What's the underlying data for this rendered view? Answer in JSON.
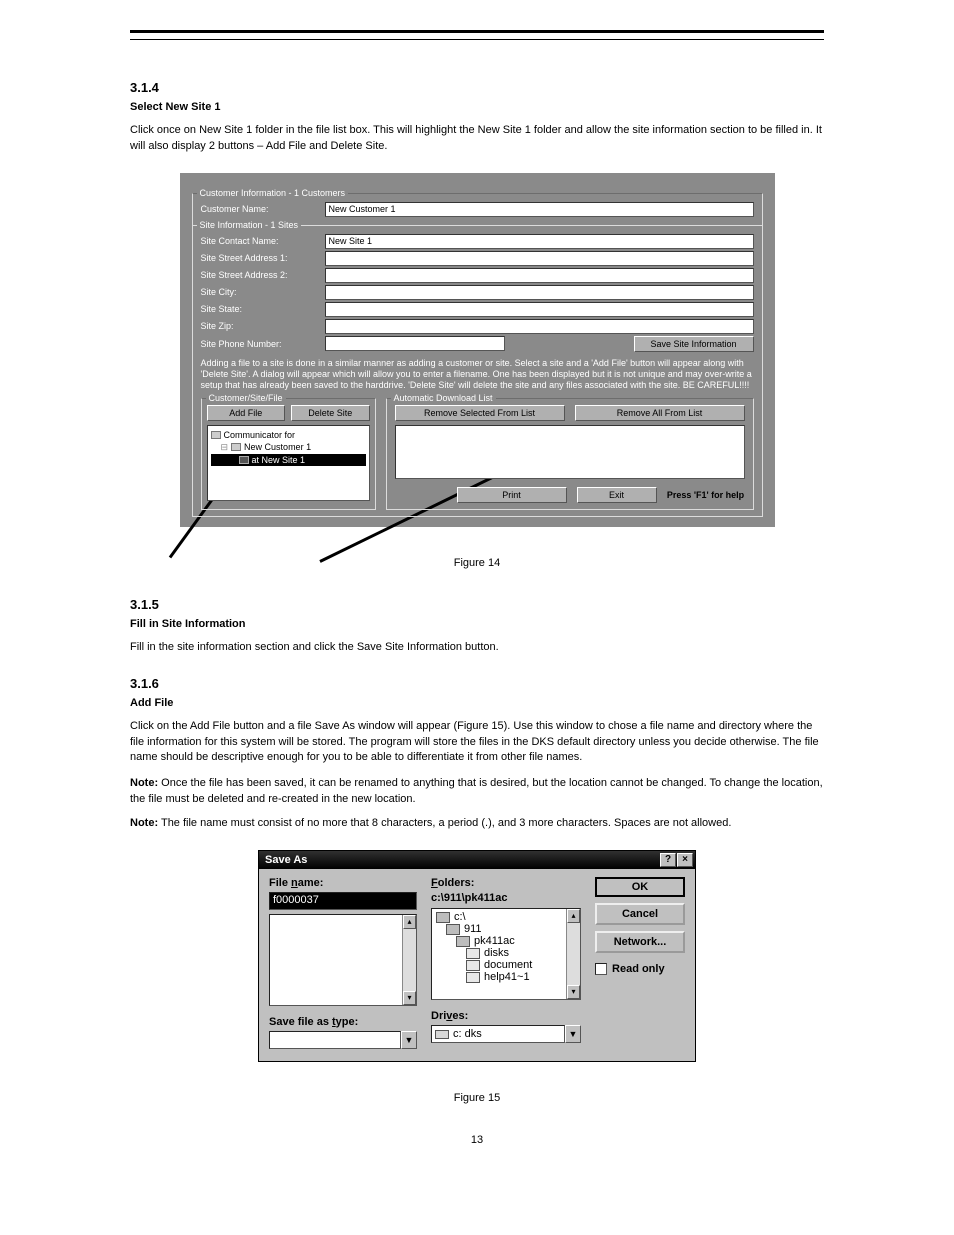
{
  "section1": {
    "num": "3.1.4",
    "title": "Select New Site 1"
  },
  "para1": "Click once on New Site 1 folder in the file list box. This will highlight the New Site 1 folder and allow the site information section to be filled in. It will also display 2 buttons – Add File and Delete Site.",
  "fig1": {
    "group_customer": "Customer Information - 1 Customers",
    "customer_name_label": "Customer Name:",
    "customer_name_value": "New Customer 1",
    "group_site": "Site Information - 1 Sites",
    "labels": {
      "contact": "Site Contact Name:",
      "addr1": "Site Street Address 1:",
      "addr2": "Site Street Address 2:",
      "city": "Site City:",
      "state": "Site State:",
      "zip": "Site Zip:",
      "phone": "Site Phone Number:"
    },
    "site_contact_value": "New Site 1",
    "save_btn": "Save Site Information",
    "help": "Adding a file to a site is done in a similar manner as adding a customer or site. Select a site and a 'Add File' button will appear along with 'Delete Site'. A dialog will appear which will allow you to enter a filename. One has been displayed but it is not unique and may over-write a setup that has already been saved to the harddrive. 'Delete Site' will delete the site and any files associated with the site. BE CAREFUL!!!!",
    "group_csf": "Customer/Site/File",
    "add_file_btn": "Add File",
    "delete_site_btn": "Delete Site",
    "tree": {
      "root": "Communicator for",
      "cust": "New Customer 1",
      "site": "at New Site 1"
    },
    "group_dl": "Automatic Download List",
    "remove_sel_btn": "Remove Selected From List",
    "remove_all_btn": "Remove All From List",
    "print_btn": "Print",
    "exit_btn": "Exit",
    "f1": "Press 'F1' for help"
  },
  "caption1": "Figure 14",
  "section2": {
    "num": "3.1.5",
    "title": "Fill in Site Information"
  },
  "para2": "Fill in the site information section and click the Save Site Information button.",
  "section3": {
    "num": "3.1.6",
    "title": "Add File"
  },
  "para3": "Click on the Add File button and a file Save As window will appear (Figure 15). Use this window to chose a file name and directory where the file information for this system will be stored. The program will store the files in the DKS default directory unless you decide otherwise. The file name should be descriptive enough for you to be able to differentiate it from other file names.",
  "note1_label": "Note:",
  "note1": "Once the file has been saved, it can be renamed to anything that is desired, but the location cannot be changed. To change the location, the file must be deleted and re-created in the new location.",
  "note2_label": "Note:",
  "note2": "The file name must consist of no more that 8 characters, a period (.), and 3 more characters. Spaces are not allowed.",
  "fig2": {
    "title": "Save As",
    "filename_label": "File name:",
    "filename_value": "f0000037",
    "folders_label": "Folders:",
    "folders_path": "c:\\911\\pk411ac",
    "folder_items": [
      "c:\\",
      "911",
      "pk411ac",
      "disks",
      "document",
      "help41~1"
    ],
    "save_type_label": "Save file as type:",
    "drives_label": "Drives:",
    "drive_value": "c: dks",
    "ok": "OK",
    "cancel": "Cancel",
    "network": "Network...",
    "readonly": "Read only"
  },
  "caption2": "Figure 15",
  "pagenum": "13"
}
